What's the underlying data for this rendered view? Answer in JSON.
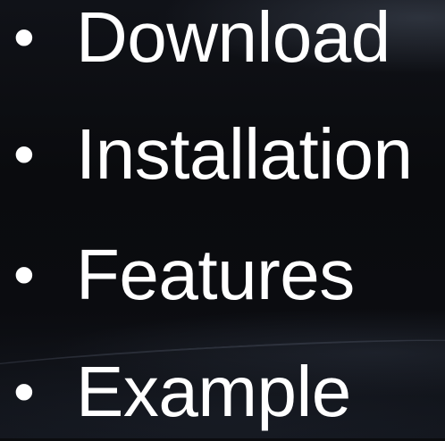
{
  "slide": {
    "items": [
      {
        "bullet": "•",
        "label": "Download"
      },
      {
        "bullet": "•",
        "label": "Installation"
      },
      {
        "bullet": "•",
        "label": "Features"
      },
      {
        "bullet": "•",
        "label": "Example"
      }
    ]
  },
  "colors": {
    "background": "#0b0c0f",
    "text": "#ffffff"
  }
}
